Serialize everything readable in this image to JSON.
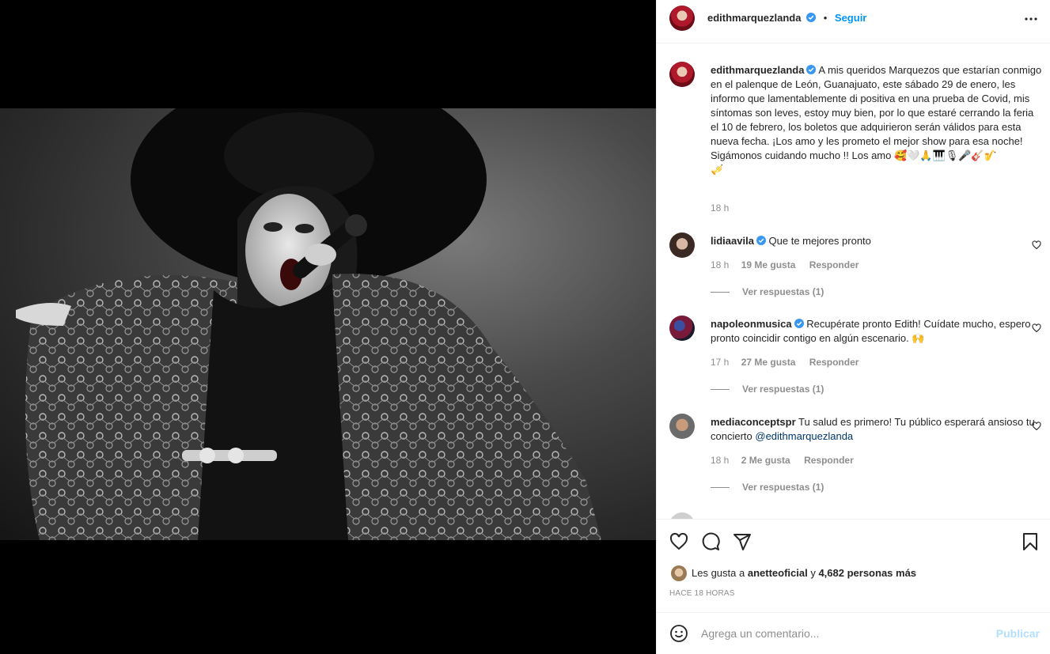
{
  "post": {
    "username": "edithmarquezlanda",
    "follow_label": "Seguir",
    "more_label": "•••",
    "caption": "A mis queridos Marquezos que estarían conmigo en el palenque de León, Guanajuato, este sábado 29 de enero, les informo que lamentablemente di positiva en una prueba de Covid, mis síntomas son leves, estoy muy bien, por lo que estaré cerrando la feria el 10 de febrero, los boletos que adquirieron serán válidos para esta nueva fecha. ¡Los amo y les prometo el mejor show para esa noche!",
    "caption_line2": "Sigámonos cuidando mucho !! Los amo 🥰🤍🙏🎹🎙🎤🎸🎷",
    "caption_line3": "🎺",
    "caption_time": "18 h"
  },
  "comments": [
    {
      "username": "lidiaavila",
      "verified": true,
      "text": "Que te mejores pronto",
      "time": "18 h",
      "likes": "19 Me gusta",
      "reply": "Responder",
      "view_replies": "Ver respuestas (1)"
    },
    {
      "username": "napoleonmusica",
      "verified": true,
      "text": "Recupérate pronto Edith! Cuídate mucho, espero pronto coincidir contigo en algún escenario. 🙌",
      "time": "17 h",
      "likes": "27 Me gusta",
      "reply": "Responder",
      "view_replies": "Ver respuestas (1)"
    },
    {
      "username": "mediaconceptspr",
      "verified": false,
      "text": "Tu salud es primero! Tu público esperará ansioso tu concierto ",
      "mention": "@edithmarquezlanda",
      "time": "18 h",
      "likes": "2 Me gusta",
      "reply": "Responder",
      "view_replies": "Ver respuestas (1)"
    }
  ],
  "likes": {
    "prefix": "Les gusta a",
    "user": "anetteoficial",
    "joiner": "y",
    "count": "4,682 personas más"
  },
  "timestamp": "HACE 18 HORAS",
  "add_comment": {
    "placeholder": "Agrega un comentario...",
    "publish": "Publicar"
  },
  "colors": {
    "accent": "#0095f6",
    "verified": "#3897f0",
    "muted": "#8e8e8e",
    "publish_disabled": "#b2dffc"
  },
  "icons": [
    "verified-badge-icon",
    "more-options-icon",
    "heart-icon",
    "comment-icon",
    "share-icon",
    "save-icon",
    "emoji-icon"
  ]
}
